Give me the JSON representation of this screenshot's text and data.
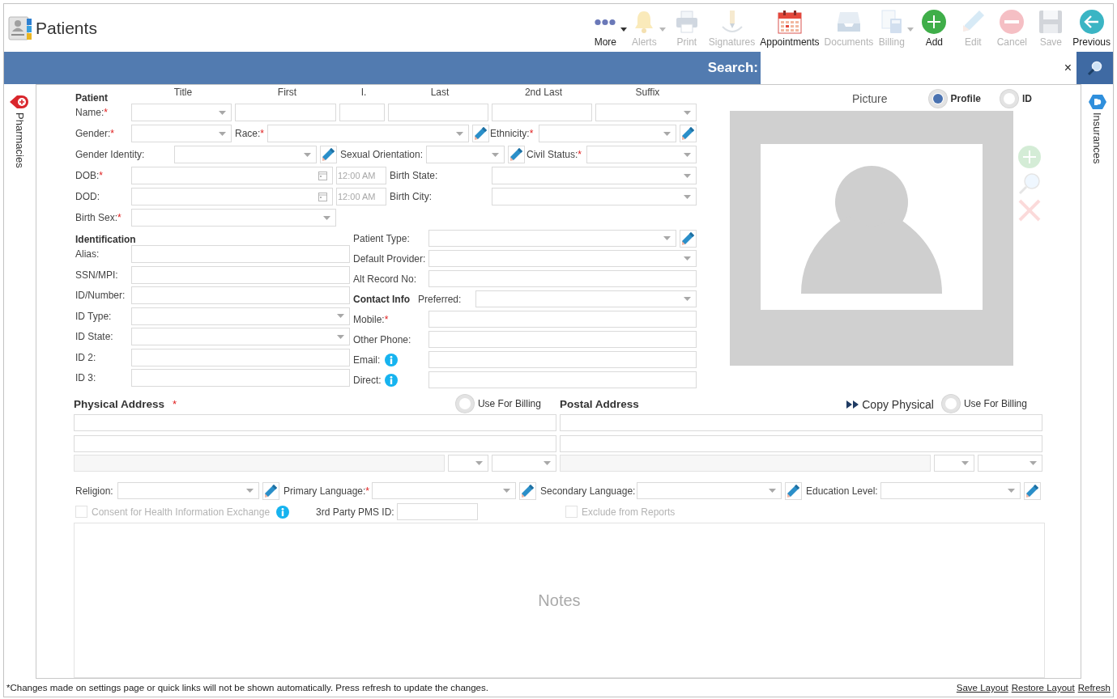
{
  "header": {
    "title": "Patients"
  },
  "toolbar": [
    {
      "kind": "more",
      "label": "More",
      "disabled": false,
      "dropdown": true
    },
    {
      "kind": "alerts",
      "label": "Alerts",
      "disabled": true,
      "dropdown": true
    },
    {
      "kind": "print",
      "label": "Print",
      "disabled": true,
      "dropdown": false
    },
    {
      "kind": "signatures",
      "label": "Signatures",
      "disabled": true,
      "dropdown": false
    },
    {
      "kind": "appointments",
      "label": "Appointments",
      "disabled": false,
      "dropdown": false
    },
    {
      "kind": "documents",
      "label": "Documents",
      "disabled": true,
      "dropdown": false
    },
    {
      "kind": "billing",
      "label": "Billing",
      "disabled": true,
      "dropdown": true
    },
    {
      "kind": "add",
      "label": "Add",
      "disabled": false,
      "dropdown": false
    },
    {
      "kind": "edit",
      "label": "Edit",
      "disabled": true,
      "dropdown": false
    },
    {
      "kind": "cancel",
      "label": "Cancel",
      "disabled": true,
      "dropdown": false
    },
    {
      "kind": "save",
      "label": "Save",
      "disabled": true,
      "dropdown": false
    },
    {
      "kind": "previous",
      "label": "Previous",
      "disabled": false,
      "dropdown": false
    }
  ],
  "search": {
    "label": "Search:",
    "clear": "×"
  },
  "side_tabs": {
    "left": {
      "label": "Pharmacies"
    },
    "right": {
      "label": "Insurances"
    }
  },
  "patient": {
    "heading": "Patient",
    "columns": [
      "Title",
      "First",
      "I.",
      "Last",
      "2nd Last",
      "Suffix"
    ],
    "rows": [
      [
        {
          "kind": "label",
          "text": "Name:",
          "mark": "*"
        },
        {
          "kind": "select"
        },
        {
          "kind": "text"
        },
        {
          "kind": "text"
        },
        {
          "kind": "text"
        },
        {
          "kind": "text"
        },
        {
          "kind": "select"
        }
      ],
      [
        {
          "kind": "label",
          "text": "Gender:",
          "mark": "*"
        },
        {
          "kind": "select"
        },
        {
          "kind": "label",
          "text": "Race:",
          "mark": "*"
        },
        {
          "kind": "select"
        },
        {
          "kind": "edit"
        },
        {
          "kind": "label",
          "text": "Ethnicity:",
          "mark": "*"
        },
        {
          "kind": "select"
        },
        {
          "kind": "edit"
        }
      ],
      [
        {
          "kind": "label",
          "text": "Gender Identity:"
        },
        {
          "kind": "select"
        },
        {
          "kind": "edit"
        },
        {
          "kind": "label",
          "text": "Sexual Orientation:"
        },
        {
          "kind": "select"
        },
        {
          "kind": "edit"
        },
        {
          "kind": "label",
          "text": "Civil Status:",
          "mark": "*"
        },
        {
          "kind": "select"
        }
      ],
      [
        {
          "kind": "label",
          "text": "DOB:",
          "mark": "*"
        },
        {
          "kind": "date"
        },
        {
          "kind": "time",
          "placeholder": "12:00 AM"
        },
        {
          "kind": "label",
          "text": "Birth State:"
        },
        {
          "kind": "select"
        }
      ],
      [
        {
          "kind": "label",
          "text": "DOD:"
        },
        {
          "kind": "date"
        },
        {
          "kind": "time",
          "placeholder": "12:00 AM"
        },
        {
          "kind": "label",
          "text": "Birth City:"
        },
        {
          "kind": "select"
        }
      ],
      [
        {
          "kind": "label",
          "text": "Birth Sex:",
          "mark": "*"
        },
        {
          "kind": "select"
        }
      ]
    ]
  },
  "identification": {
    "heading": "Identification",
    "rows": [
      [
        {
          "kind": "label",
          "text": "Alias:"
        },
        {
          "kind": "text"
        }
      ],
      [
        {
          "kind": "label",
          "text": "SSN/MPI:"
        },
        {
          "kind": "text"
        }
      ],
      [
        {
          "kind": "label",
          "text": "ID/Number:"
        },
        {
          "kind": "text"
        }
      ],
      [
        {
          "kind": "label",
          "text": "ID Type:"
        },
        {
          "kind": "select"
        }
      ],
      [
        {
          "kind": "label",
          "text": "ID State:"
        },
        {
          "kind": "select"
        }
      ],
      [
        {
          "kind": "label",
          "text": "ID 2:"
        },
        {
          "kind": "text"
        }
      ],
      [
        {
          "kind": "label",
          "text": "ID 3:"
        },
        {
          "kind": "text"
        }
      ]
    ]
  },
  "details": {
    "rows": [
      [
        {
          "kind": "label",
          "text": "Patient Type:"
        },
        {
          "kind": "select"
        },
        {
          "kind": "edit"
        }
      ],
      [
        {
          "kind": "label",
          "text": "Default Provider:"
        },
        {
          "kind": "select"
        }
      ],
      [
        {
          "kind": "label",
          "text": "Alt Record No:"
        },
        {
          "kind": "text"
        }
      ],
      [
        {
          "kind": "heading",
          "text": "Contact Info"
        },
        {
          "kind": "label",
          "text": "Preferred:"
        },
        {
          "kind": "select"
        }
      ],
      [
        {
          "kind": "label",
          "text": "Mobile:",
          "mark": "*"
        },
        {
          "kind": "text"
        }
      ],
      [
        {
          "kind": "label",
          "text": "Other Phone:"
        },
        {
          "kind": "text"
        }
      ],
      [
        {
          "kind": "label",
          "text": "Email:"
        },
        {
          "kind": "info"
        },
        {
          "kind": "text"
        }
      ],
      [
        {
          "kind": "label",
          "text": "Direct:"
        },
        {
          "kind": "info"
        },
        {
          "kind": "text"
        }
      ]
    ]
  },
  "picture": {
    "label": "Picture",
    "options": [
      {
        "label": "Profile",
        "selected": true
      },
      {
        "label": "ID",
        "selected": false
      }
    ],
    "actions": [
      {
        "kind": "add",
        "disabled": true
      },
      {
        "kind": "zoom",
        "disabled": true
      },
      {
        "kind": "delete",
        "disabled": true
      }
    ]
  },
  "physical_address": {
    "heading": "Physical Address",
    "mark": "*",
    "use_for_billing": {
      "label": "Use For Billing",
      "selected": false
    },
    "rows": [
      [
        {
          "kind": "text"
        }
      ],
      [
        {
          "kind": "text"
        }
      ],
      [
        {
          "kind": "disabled"
        },
        {
          "kind": "select"
        },
        {
          "kind": "select"
        }
      ]
    ]
  },
  "postal_address": {
    "heading": "Postal Address",
    "copy": "Copy Physical",
    "use_for_billing": {
      "label": "Use For Billing",
      "selected": false
    },
    "rows": [
      [
        {
          "kind": "text"
        }
      ],
      [
        {
          "kind": "text"
        }
      ],
      [
        {
          "kind": "disabled"
        },
        {
          "kind": "select"
        },
        {
          "kind": "select"
        }
      ]
    ]
  },
  "demographics": [
    {
      "kind": "label",
      "text": "Religion:"
    },
    {
      "kind": "select"
    },
    {
      "kind": "edit"
    },
    {
      "kind": "label",
      "text": "Primary Language:",
      "mark": "*"
    },
    {
      "kind": "select"
    },
    {
      "kind": "edit"
    },
    {
      "kind": "label",
      "text": "Secondary Language:"
    },
    {
      "kind": "select"
    },
    {
      "kind": "edit"
    },
    {
      "kind": "label",
      "text": "Education Level:"
    },
    {
      "kind": "select"
    },
    {
      "kind": "edit"
    }
  ],
  "options": {
    "consent": {
      "label": "Consent for Health Information Exchange",
      "checked": false,
      "disabled": true
    },
    "pms_label": "3rd Party PMS ID:",
    "exclude": {
      "label": "Exclude from Reports",
      "checked": false,
      "disabled": true
    }
  },
  "notes": {
    "placeholder": "Notes"
  },
  "footer": {
    "note": "*Changes made on settings page or quick links will not be shown automatically. Press refresh to update the changes.",
    "links": [
      "Save Layout",
      "Restore Layout",
      "Refresh"
    ]
  }
}
